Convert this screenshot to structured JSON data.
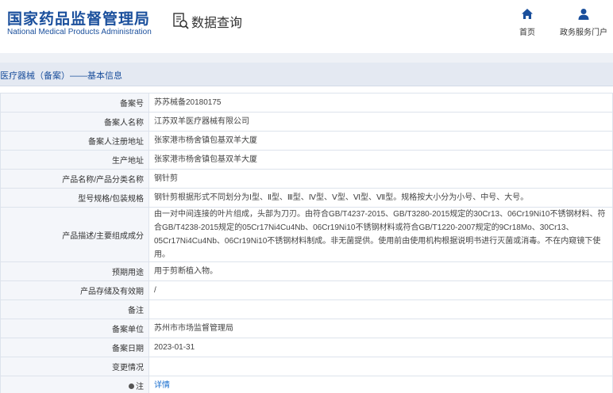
{
  "header": {
    "logo_cn": "国家药品监督管理局",
    "logo_en": "National Medical Products Administration",
    "query_label": "数据查询",
    "query_icon": "document-search-icon",
    "nav": [
      {
        "label": "首页",
        "icon": "home-icon"
      },
      {
        "label": "政务服务门户",
        "icon": "user-icon"
      }
    ]
  },
  "breadcrumb": "医疗器械（备案）——基本信息",
  "rows": [
    {
      "key": "备案号",
      "value": "苏苏械备20180175"
    },
    {
      "key": "备案人名称",
      "value": "江苏双羊医疗器械有限公司"
    },
    {
      "key": "备案人注册地址",
      "value": "张家港市杨舍镇包基双羊大厦"
    },
    {
      "key": "生产地址",
      "value": "张家港市杨舍镇包基双羊大厦"
    },
    {
      "key": "产品名称/产品分类名称",
      "value": "钢针剪"
    },
    {
      "key": "型号规格/包装规格",
      "value": "钢针剪根据形式不同划分为Ⅰ型、Ⅱ型、Ⅲ型、Ⅳ型、Ⅴ型、Ⅵ型、Ⅶ型。规格按大小分为小号、中号、大号。"
    },
    {
      "key": "产品描述/主要组成成分",
      "value": "由一对中间连接的叶片组成，头部为刀刃。由符合GB/T4237-2015、GB/T3280-2015规定的30Cr13、06Cr19Ni10不锈钢材料、符合GB/T4238-2015规定的05Cr17Ni4Cu4Nb、06Cr19Ni10不锈钢材料或符合GB/T1220-2007规定的9Cr18Mo、30Cr13、05Cr17Ni4Cu4Nb、06Cr19Ni10不锈钢材料制成。非无菌提供。使用前由使用机构根据说明书进行灭菌或消毒。不在内窥镜下使用。"
    },
    {
      "key": "预期用途",
      "value": "用于剪断植入物。"
    },
    {
      "key": "产品存储及有效期",
      "value": "/"
    },
    {
      "key": "备注",
      "value": ""
    },
    {
      "key": "备案单位",
      "value": "苏州市市场监督管理局"
    },
    {
      "key": "备案日期",
      "value": "2023-01-31"
    },
    {
      "key": "变更情况",
      "value": ""
    },
    {
      "key": "注",
      "value": "详情"
    }
  ]
}
